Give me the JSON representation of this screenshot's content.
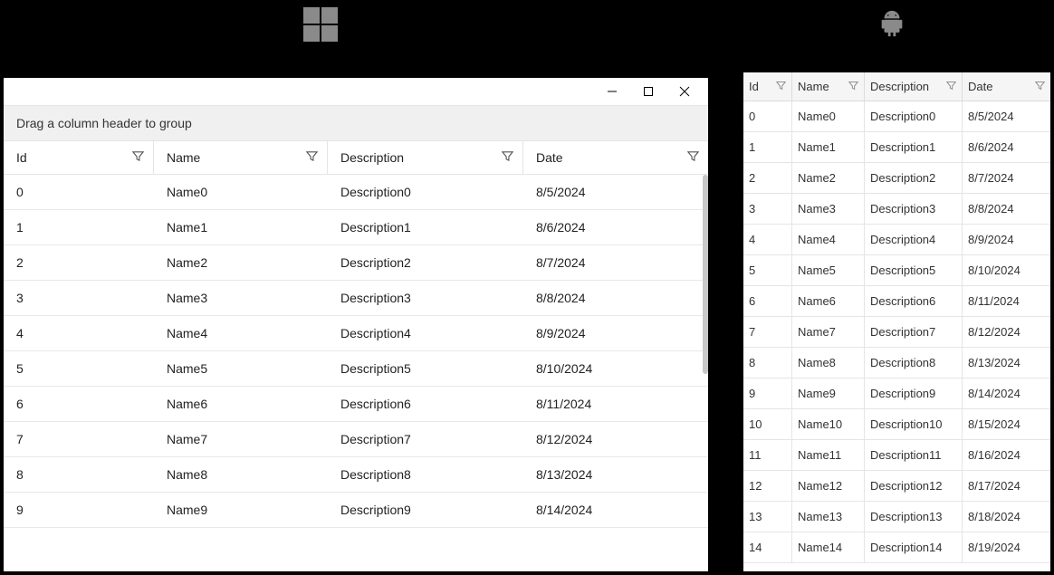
{
  "platforms": {
    "windows_icon": "windows-icon",
    "android_icon": "android-icon"
  },
  "windows": {
    "group_hint": "Drag a column header to group",
    "columns": {
      "id": "Id",
      "name": "Name",
      "desc": "Description",
      "date": "Date"
    },
    "rows": [
      {
        "id": "0",
        "name": "Name0",
        "desc": "Description0",
        "date": "8/5/2024"
      },
      {
        "id": "1",
        "name": "Name1",
        "desc": "Description1",
        "date": "8/6/2024"
      },
      {
        "id": "2",
        "name": "Name2",
        "desc": "Description2",
        "date": "8/7/2024"
      },
      {
        "id": "3",
        "name": "Name3",
        "desc": "Description3",
        "date": "8/8/2024"
      },
      {
        "id": "4",
        "name": "Name4",
        "desc": "Description4",
        "date": "8/9/2024"
      },
      {
        "id": "5",
        "name": "Name5",
        "desc": "Description5",
        "date": "8/10/2024"
      },
      {
        "id": "6",
        "name": "Name6",
        "desc": "Description6",
        "date": "8/11/2024"
      },
      {
        "id": "7",
        "name": "Name7",
        "desc": "Description7",
        "date": "8/12/2024"
      },
      {
        "id": "8",
        "name": "Name8",
        "desc": "Description8",
        "date": "8/13/2024"
      },
      {
        "id": "9",
        "name": "Name9",
        "desc": "Description9",
        "date": "8/14/2024"
      }
    ]
  },
  "android": {
    "columns": {
      "id": "Id",
      "name": "Name",
      "desc": "Description",
      "date": "Date"
    },
    "rows": [
      {
        "id": "0",
        "name": "Name0",
        "desc": "Description0",
        "date": "8/5/2024"
      },
      {
        "id": "1",
        "name": "Name1",
        "desc": "Description1",
        "date": "8/6/2024"
      },
      {
        "id": "2",
        "name": "Name2",
        "desc": "Description2",
        "date": "8/7/2024"
      },
      {
        "id": "3",
        "name": "Name3",
        "desc": "Description3",
        "date": "8/8/2024"
      },
      {
        "id": "4",
        "name": "Name4",
        "desc": "Description4",
        "date": "8/9/2024"
      },
      {
        "id": "5",
        "name": "Name5",
        "desc": "Description5",
        "date": "8/10/2024"
      },
      {
        "id": "6",
        "name": "Name6",
        "desc": "Description6",
        "date": "8/11/2024"
      },
      {
        "id": "7",
        "name": "Name7",
        "desc": "Description7",
        "date": "8/12/2024"
      },
      {
        "id": "8",
        "name": "Name8",
        "desc": "Description8",
        "date": "8/13/2024"
      },
      {
        "id": "9",
        "name": "Name9",
        "desc": "Description9",
        "date": "8/14/2024"
      },
      {
        "id": "10",
        "name": "Name10",
        "desc": "Description10",
        "date": "8/15/2024"
      },
      {
        "id": "11",
        "name": "Name11",
        "desc": "Description11",
        "date": "8/16/2024"
      },
      {
        "id": "12",
        "name": "Name12",
        "desc": "Description12",
        "date": "8/17/2024"
      },
      {
        "id": "13",
        "name": "Name13",
        "desc": "Description13",
        "date": "8/18/2024"
      },
      {
        "id": "14",
        "name": "Name14",
        "desc": "Description14",
        "date": "8/19/2024"
      }
    ]
  }
}
